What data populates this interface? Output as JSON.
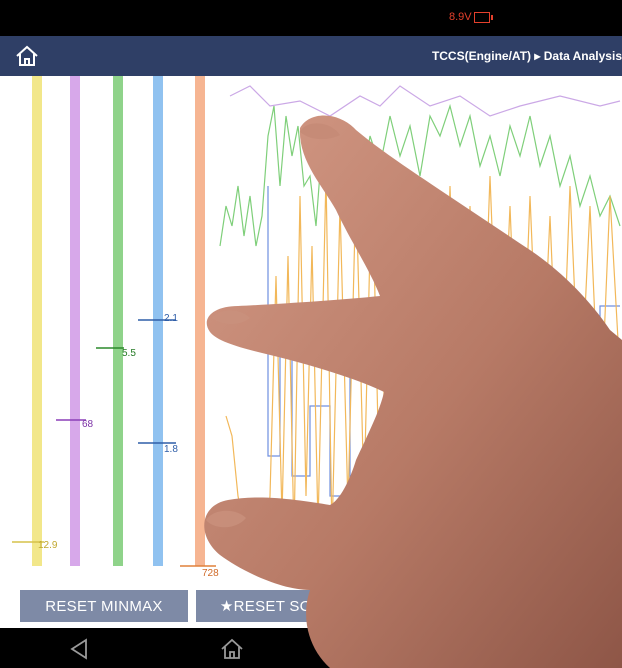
{
  "status": {
    "battery_text": "8.9V"
  },
  "app_bar": {
    "breadcrumb": "TCCS(Engine/AT) ▸ Data Analysis"
  },
  "graph": {
    "channels": [
      {
        "name": "yellow",
        "color": "#f2e78a",
        "marker": "12.9"
      },
      {
        "name": "purple",
        "color": "#d7a8ea",
        "marker": "68"
      },
      {
        "name": "green",
        "color": "#8fd38a",
        "marker": "5.5"
      },
      {
        "name": "blue",
        "color": "#90c2f0",
        "marker": "2.1",
        "marker2": "1.8"
      },
      {
        "name": "orange",
        "color": "#f6b592",
        "marker": "728"
      }
    ]
  },
  "buttons": {
    "reset_minmax": "RESET MINMAX",
    "reset_scale": "★RESET SCALE",
    "third": ""
  },
  "icons": {
    "home": "home-icon",
    "back": "back-icon",
    "nav_home": "home-icon",
    "recent": "recent-apps-icon",
    "globe": "globe-icon"
  }
}
